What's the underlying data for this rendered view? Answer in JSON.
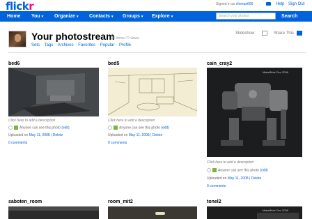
{
  "header": {
    "logo_a": "flick",
    "logo_b": "r",
    "signed_in_prefix": "Signed in as",
    "signed_in_user": "cheeps666",
    "help": "Help",
    "sign_out": "Sign Out"
  },
  "nav": {
    "items": [
      "Home",
      "You",
      "Organize",
      "Contacts",
      "Groups",
      "Explore"
    ],
    "search_placeholder": "Search your photos",
    "search_button": "Search"
  },
  "stream": {
    "title": "Your photostream",
    "count": "36 items / 0 views",
    "links": [
      "Sets",
      "Tags",
      "Archives",
      "Favorites",
      "Popular",
      "Profile"
    ],
    "slideshow": "Slideshow",
    "share": "Share This"
  },
  "photos": [
    {
      "name": "bed6",
      "desc": "Click here to add a description",
      "who": "Anyone can see this photo",
      "edit": "(edit)",
      "uploaded": "Uploaded on",
      "date": "May 11, 2008",
      "delete": "Delete",
      "comments": "0 comments"
    },
    {
      "name": "bed5",
      "desc": "Click here to add a description",
      "who": "Anyone can see this photo",
      "edit": "(edit)",
      "uploaded": "Uploaded on",
      "date": "May 11, 2008",
      "delete": "Delete",
      "comments": "0 comments"
    },
    {
      "name": "cain_cray2",
      "desc": "Click here to add a description",
      "who": "Anyone can see this photo",
      "edit": "(edit)",
      "uploaded": "Uploaded on",
      "date": "May 11, 2008",
      "delete": "Delete",
      "comments": "0 comments"
    },
    {
      "name": "saboten_room"
    },
    {
      "name": "room_mit2"
    },
    {
      "name": "tonel2"
    }
  ],
  "watermark": "MakeBible Dec 2008"
}
